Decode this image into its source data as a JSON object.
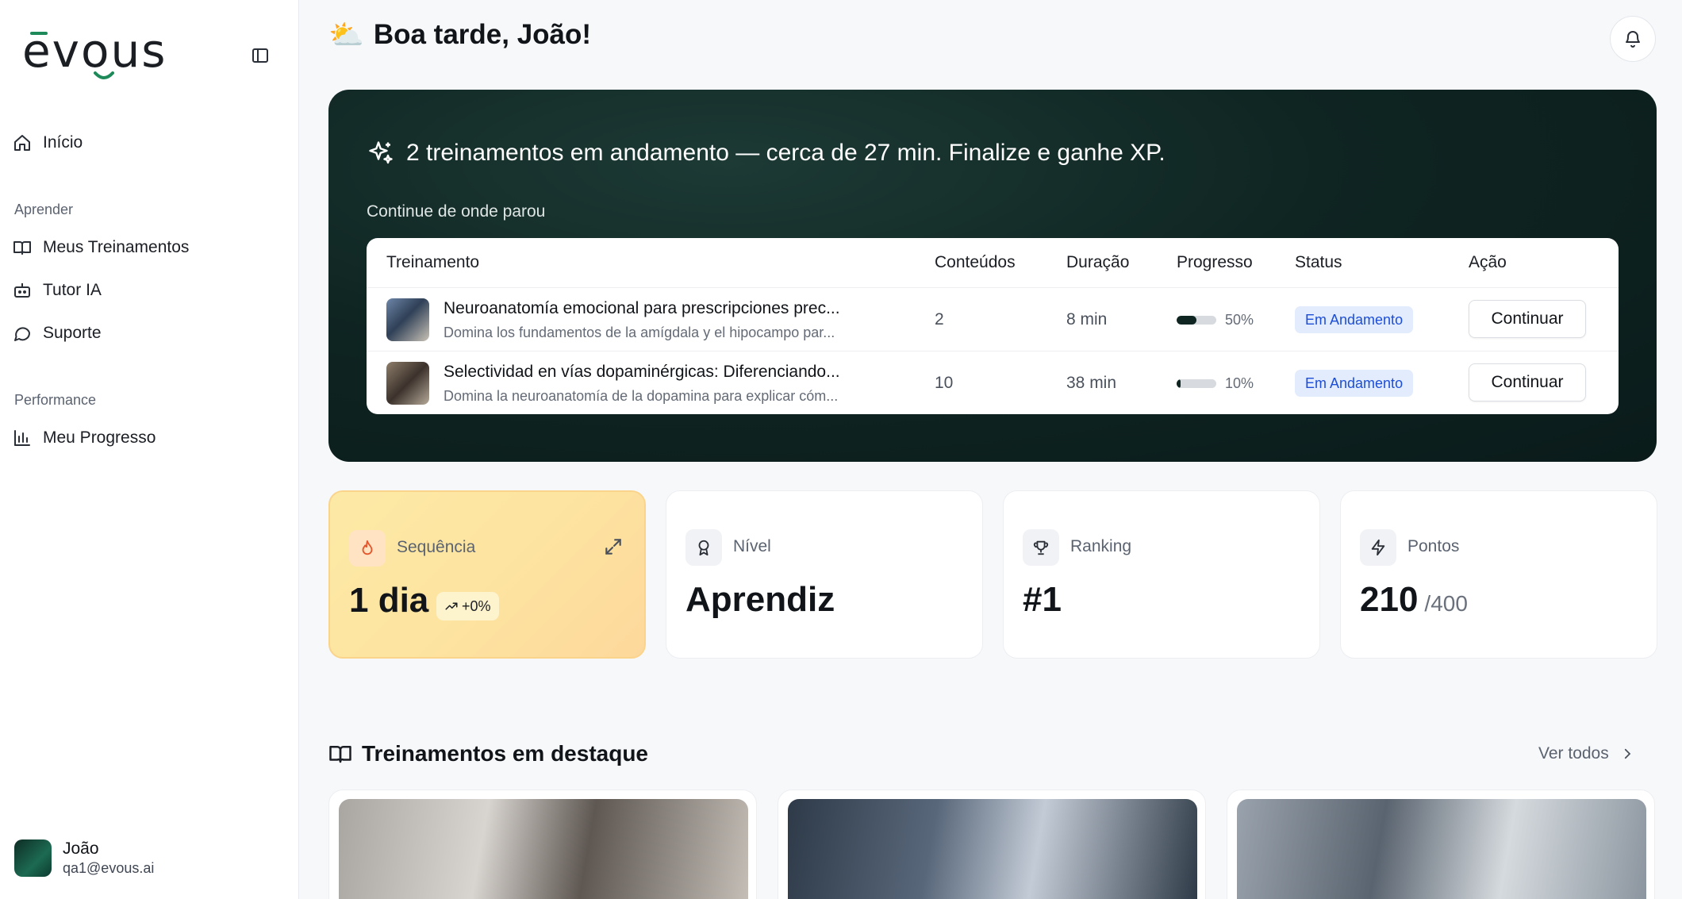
{
  "brand": {
    "logo_text": "evous"
  },
  "sidebar": {
    "home": {
      "label": "Início"
    },
    "sections": [
      {
        "title": "Aprender",
        "items": [
          {
            "label": "Meus Treinamentos"
          },
          {
            "label": "Tutor IA"
          },
          {
            "label": "Suporte"
          }
        ]
      },
      {
        "title": "Performance",
        "items": [
          {
            "label": "Meu Progresso"
          }
        ]
      }
    ]
  },
  "user": {
    "name": "João",
    "email": "qa1@evous.ai"
  },
  "header": {
    "emoji": "⛅",
    "greeting": "Boa tarde, João!"
  },
  "hero": {
    "title": "2 treinamentos em andamento — cerca de 27 min. Finalize e ganhe XP.",
    "subtitle": "Continue de onde parou",
    "columns": [
      "Treinamento",
      "Conteúdos",
      "Duração",
      "Progresso",
      "Status",
      "Ação"
    ],
    "rows": [
      {
        "title": "Neuroanatomía emocional para prescripciones prec...",
        "desc": "Domina los fundamentos de la amígdala y el hipocampo par...",
        "contents": "2",
        "duration": "8 min",
        "progress": 50,
        "progress_label": "50%",
        "status": "Em Andamento",
        "action": "Continuar"
      },
      {
        "title": "Selectividad en vías dopaminérgicas: Diferenciando...",
        "desc": "Domina la neuroanatomía de la dopamina para explicar cóm...",
        "contents": "10",
        "duration": "38 min",
        "progress": 10,
        "progress_label": "10%",
        "status": "Em Andamento",
        "action": "Continuar"
      }
    ]
  },
  "stats": {
    "streak": {
      "label": "Sequência",
      "value": "1 dia",
      "trend": "+0%"
    },
    "level": {
      "label": "Nível",
      "value": "Aprendiz"
    },
    "ranking": {
      "label": "Ranking",
      "value": "#1"
    },
    "points": {
      "label": "Pontos",
      "value": "210",
      "max": "/400"
    }
  },
  "featured": {
    "title": "Treinamentos em destaque",
    "see_all": "Ver todos"
  },
  "colors": {
    "hero_bg": "#0f2522",
    "status_blue": "#1d4ed8",
    "streak_bg": "#fde4a0"
  }
}
